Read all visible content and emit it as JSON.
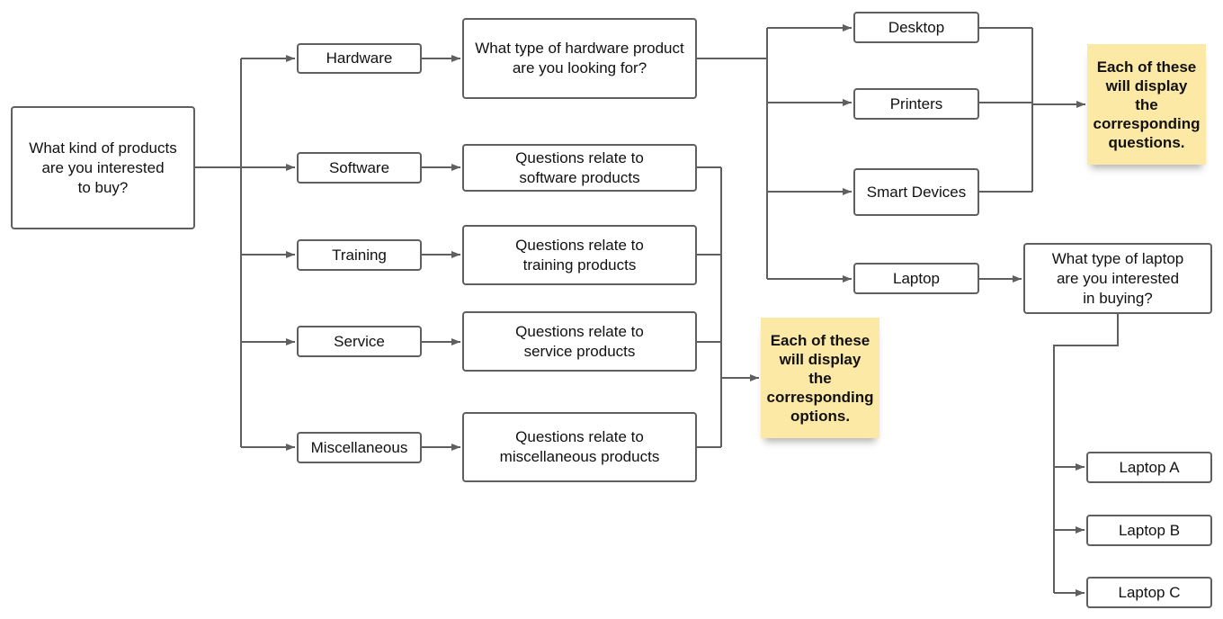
{
  "nodes": {
    "root": "What kind of products\nare you interested\nto buy?",
    "hardware": "Hardware",
    "software": "Software",
    "training": "Training",
    "service": "Service",
    "miscellaneous": "Miscellaneous",
    "q_hardware": "What type of hardware product\nare you looking for?",
    "q_software": "Questions relate to\nsoftware products",
    "q_training": "Questions relate to\ntraining products",
    "q_service": "Questions relate to\nservice products",
    "q_misc": "Questions relate to\nmiscellaneous products",
    "desktop": "Desktop",
    "printers": "Printers",
    "smart_devices": "Smart Devices",
    "laptop": "Laptop",
    "q_laptop": "What type of laptop\nare you interested\nin buying?",
    "laptop_a": "Laptop A",
    "laptop_b": "Laptop B",
    "laptop_c": "Laptop C"
  },
  "notes": {
    "options": "Each of these\nwill display\nthe\ncorresponding\noptions.",
    "questions": "Each of these\nwill display\nthe\ncorresponding\nquestions."
  },
  "colors": {
    "line": "#5f5f5f",
    "note": "#fde9a6"
  }
}
